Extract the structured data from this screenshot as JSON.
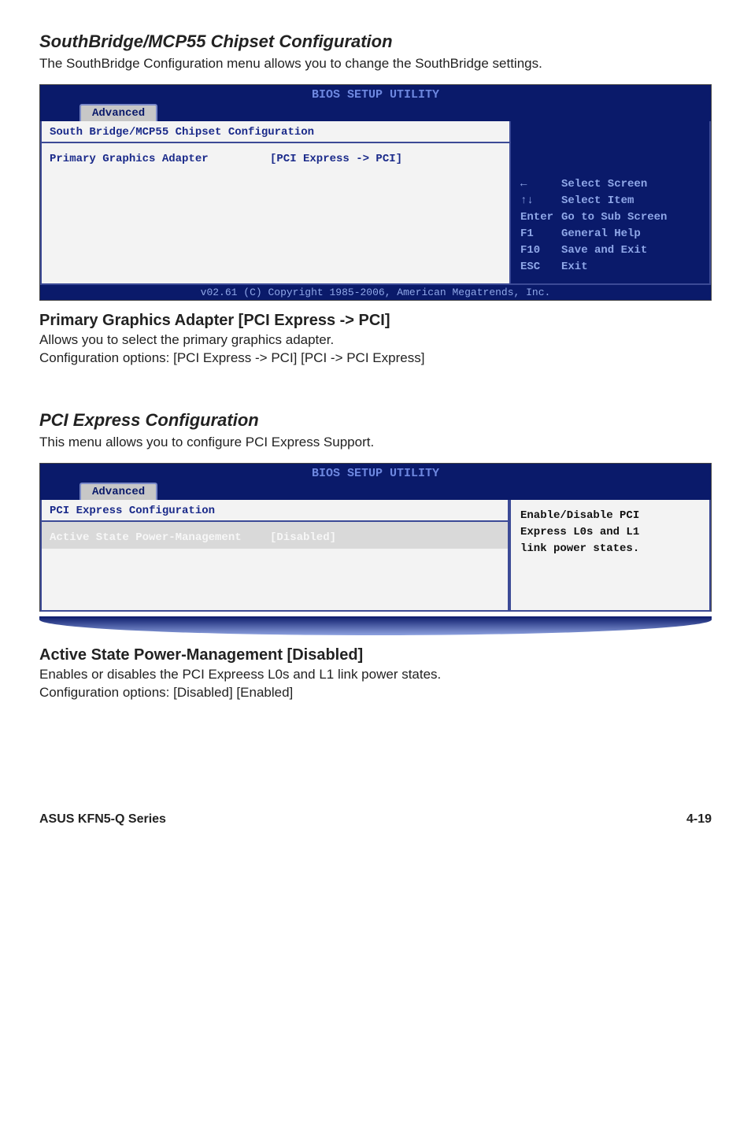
{
  "section1": {
    "title": "SouthBridge/MCP55 Chipset Configuration",
    "desc": "The SouthBridge Configuration menu allows you to change the SouthBridge settings."
  },
  "bios1": {
    "header": "BIOS SETUP UTILITY",
    "tab": "Advanced",
    "left_title": "South Bridge/MCP55 Chipset Configuration",
    "row_label": "Primary Graphics Adapter",
    "row_value": "[PCI Express -> PCI]",
    "legend": {
      "arrow_lr": "←",
      "arrow_lr_text": "Select Screen",
      "arrow_ud": "↑↓",
      "arrow_ud_text": "Select Item",
      "enter": "Enter",
      "enter_text": "Go to Sub Screen",
      "f1": "F1",
      "f1_text": "General Help",
      "f10": "F10",
      "f10_text": "Save and Exit",
      "esc": "ESC",
      "esc_text": "Exit"
    },
    "footer": "v02.61 (C) Copyright 1985-2006, American Megatrends, Inc."
  },
  "sub1": {
    "title": "Primary Graphics Adapter [PCI Express -> PCI]",
    "line1": "Allows you to select the primary graphics adapter.",
    "line2": "Configuration options: [PCI Express -> PCI] [PCI -> PCI Express]"
  },
  "section2": {
    "title": "PCI Express Configuration",
    "desc": "This menu allows you to configure PCI Express Support."
  },
  "bios2": {
    "header": "BIOS SETUP UTILITY",
    "tab": "Advanced",
    "left_title": "PCI Express Configuration",
    "row_label": "Active State Power-Management",
    "row_value": "[Disabled]",
    "help1": "Enable/Disable PCI",
    "help2": "Express L0s and L1",
    "help3": "link power states."
  },
  "sub2": {
    "title": "Active State Power-Management [Disabled]",
    "line1": "Enables or disables the PCI Expreess L0s and L1 link power states.",
    "line2": "Configuration options: [Disabled] [Enabled]"
  },
  "footer": {
    "left": "ASUS KFN5-Q Series",
    "right": "4-19"
  }
}
